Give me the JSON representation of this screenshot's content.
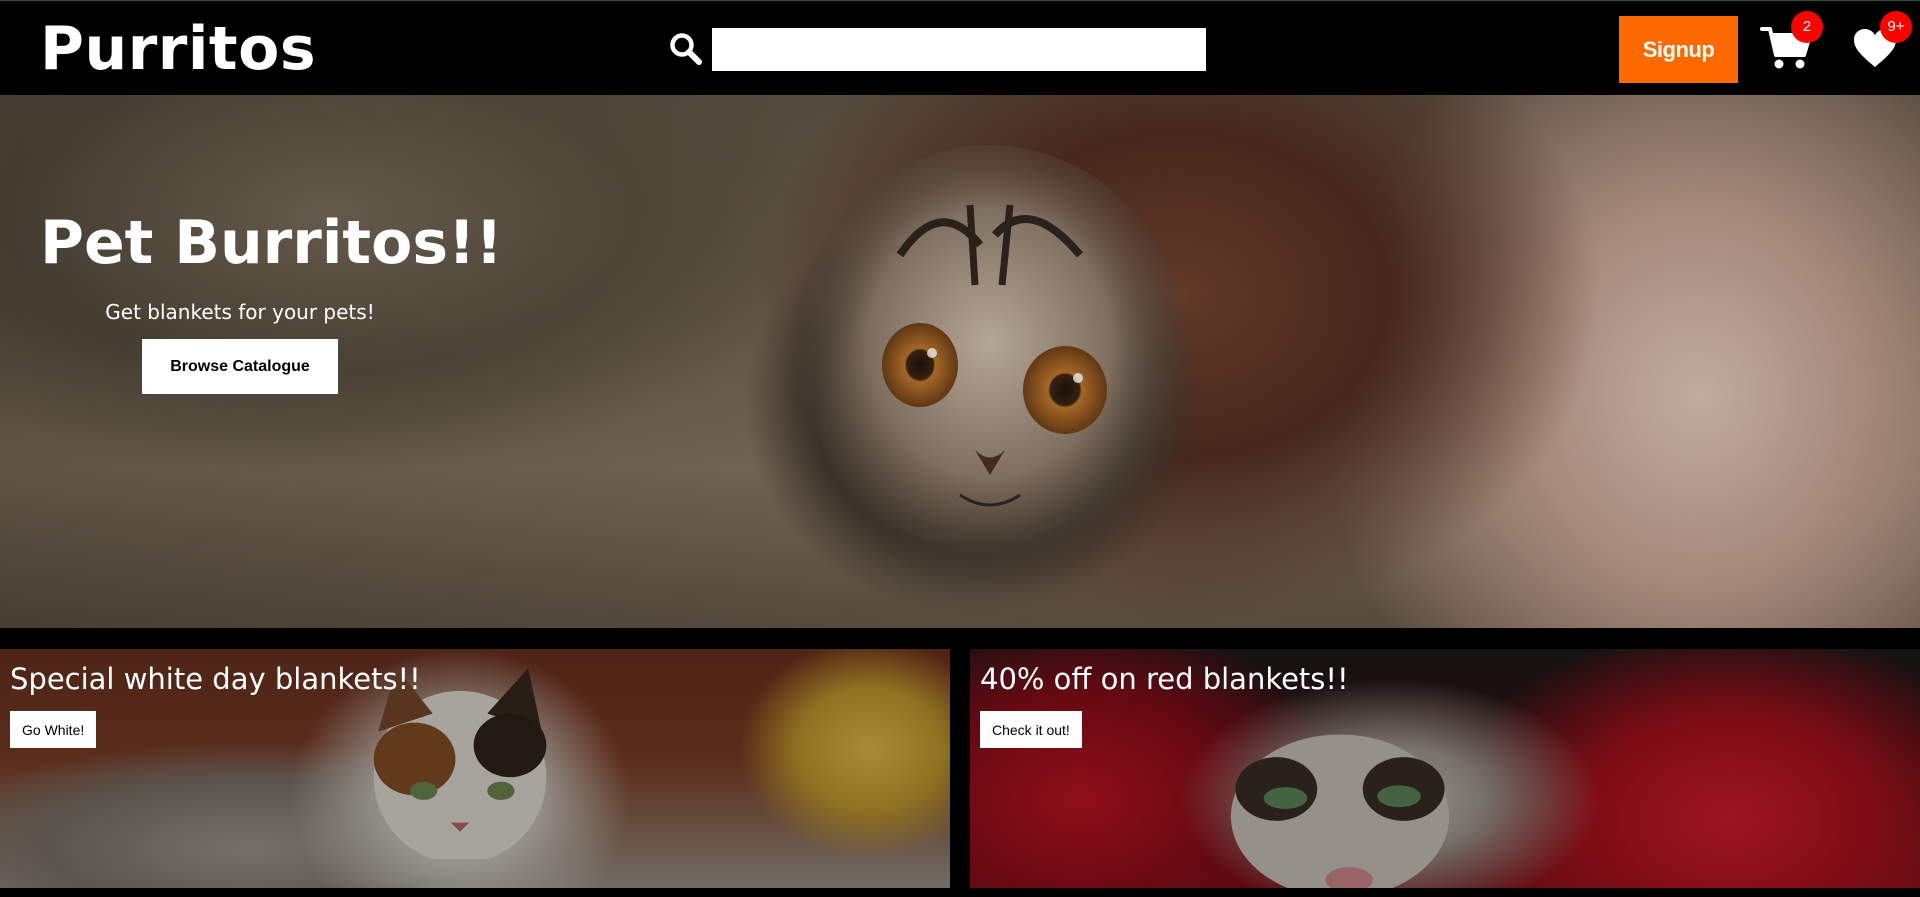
{
  "header": {
    "logo": "Purritos",
    "search": {
      "value": "",
      "placeholder": ""
    },
    "signup_label": "Signup",
    "cart_count": "2",
    "wishlist_count": "9+"
  },
  "hero": {
    "title": "Pet Burritos!!",
    "subtitle": "Get blankets for your pets!",
    "cta_label": "Browse Catalogue"
  },
  "promos": [
    {
      "title": "Special white day blankets!!",
      "cta_label": "Go White!"
    },
    {
      "title": "40% off on red blankets!!",
      "cta_label": "Check it out!"
    }
  ],
  "colors": {
    "accent": "#ff6a00",
    "badge": "#ff0000",
    "header_bg": "#000000"
  },
  "icons": [
    "search-icon",
    "cart-icon",
    "heart-icon"
  ]
}
